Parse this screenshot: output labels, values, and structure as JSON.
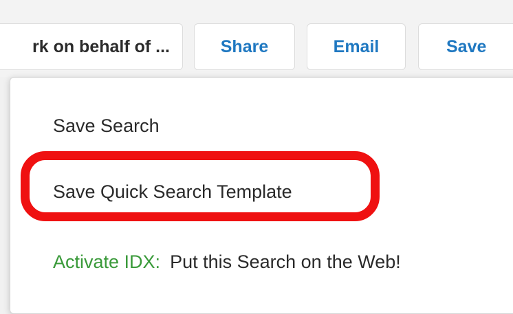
{
  "toolbar": {
    "work_label": "rk on behalf of ...",
    "share_label": "Share",
    "email_label": "Email",
    "save_label": "Save"
  },
  "save_menu": {
    "items": [
      {
        "label": "Save Search"
      },
      {
        "label": "Save Quick Search Template"
      }
    ],
    "activate": {
      "label": "Activate IDX:",
      "text": "Put this Search on the Web!"
    }
  },
  "colors": {
    "accent_blue": "#1f78c1",
    "activate_green": "#3a9a3a",
    "highlight_red": "#ef1111"
  }
}
